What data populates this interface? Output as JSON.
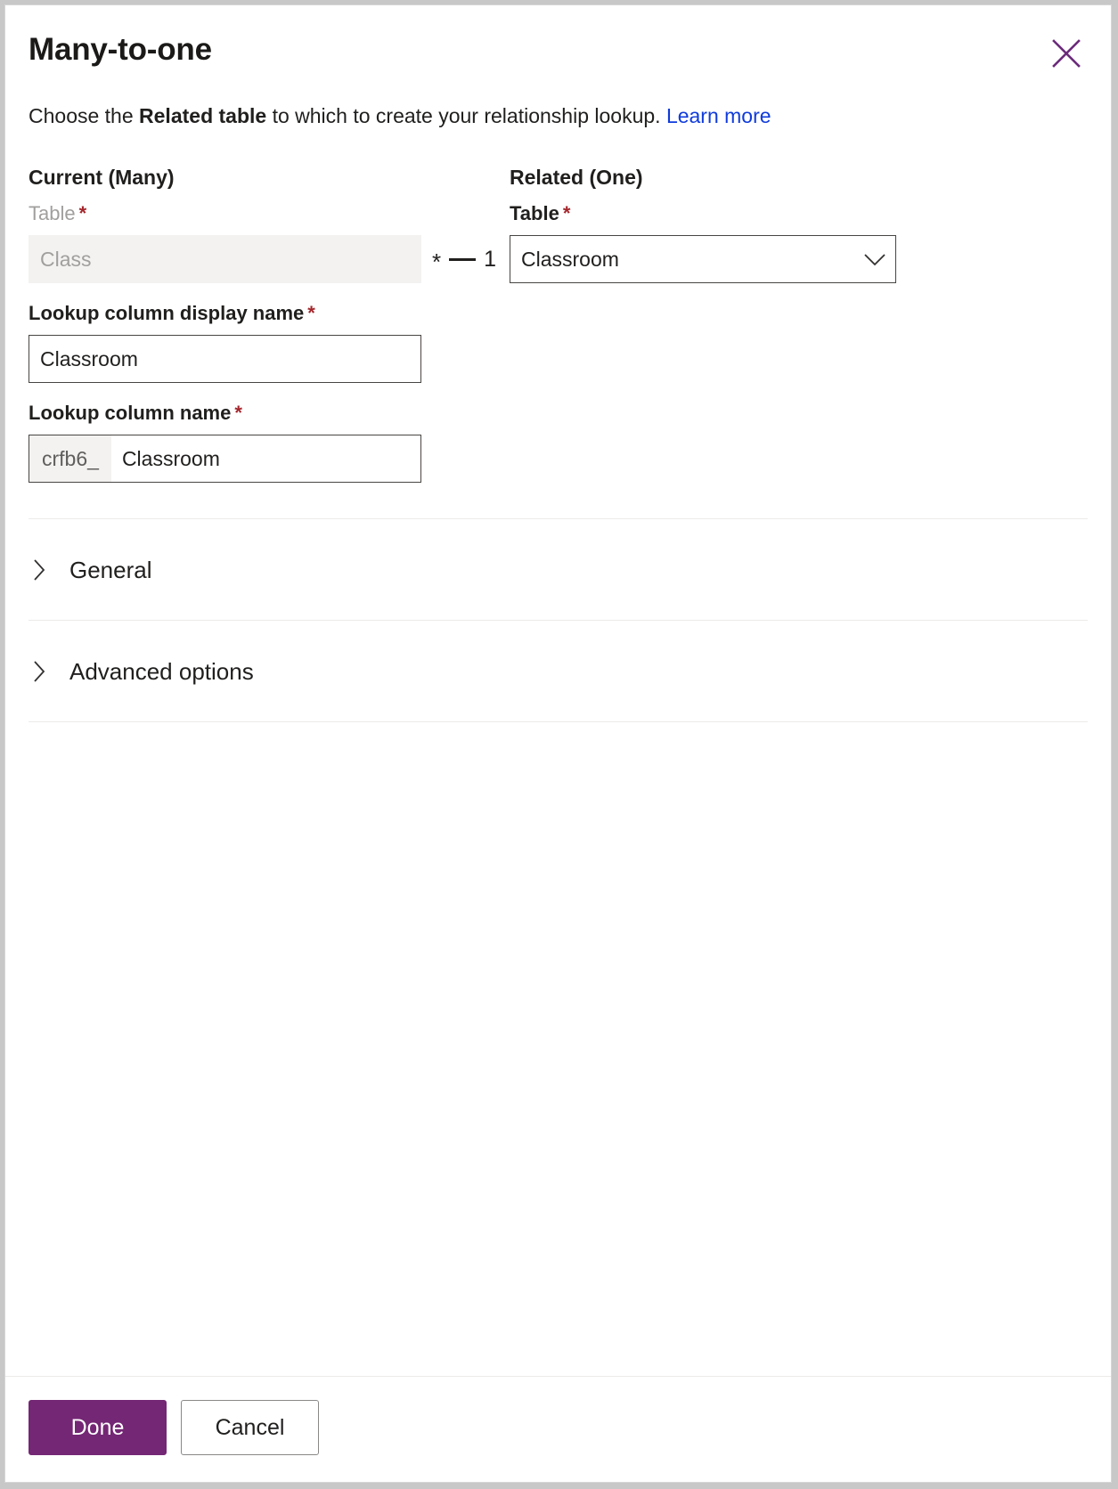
{
  "dialog": {
    "title": "Many-to-one",
    "close_label": "Close",
    "description_prefix": "Choose the ",
    "description_strong": "Related table",
    "description_suffix": " to which to create your relationship lookup. ",
    "learn_more": "Learn more"
  },
  "current": {
    "group_heading": "Current (Many)",
    "table_label": "Table",
    "table_required": "*",
    "table_value": "Class"
  },
  "relationship": {
    "many_symbol": "*",
    "one_symbol": "1"
  },
  "related": {
    "group_heading": "Related (One)",
    "table_label": "Table",
    "table_required": "*",
    "table_value": "Classroom"
  },
  "lookup_display_name": {
    "label": "Lookup column display name",
    "required": "*",
    "value": "Classroom"
  },
  "lookup_name": {
    "label": "Lookup column name",
    "required": "*",
    "prefix": "crfb6_",
    "value": "Classroom"
  },
  "sections": [
    {
      "label": "General"
    },
    {
      "label": "Advanced options"
    }
  ],
  "footer": {
    "done_label": "Done",
    "cancel_label": "Cancel"
  },
  "colors": {
    "accent": "#742774",
    "close_icon": "#6b2b7a",
    "link": "#0f3bdb",
    "required": "#a4262c",
    "readonly_bg": "#f3f2f1",
    "border": "#484644",
    "divider": "#edebe9"
  }
}
